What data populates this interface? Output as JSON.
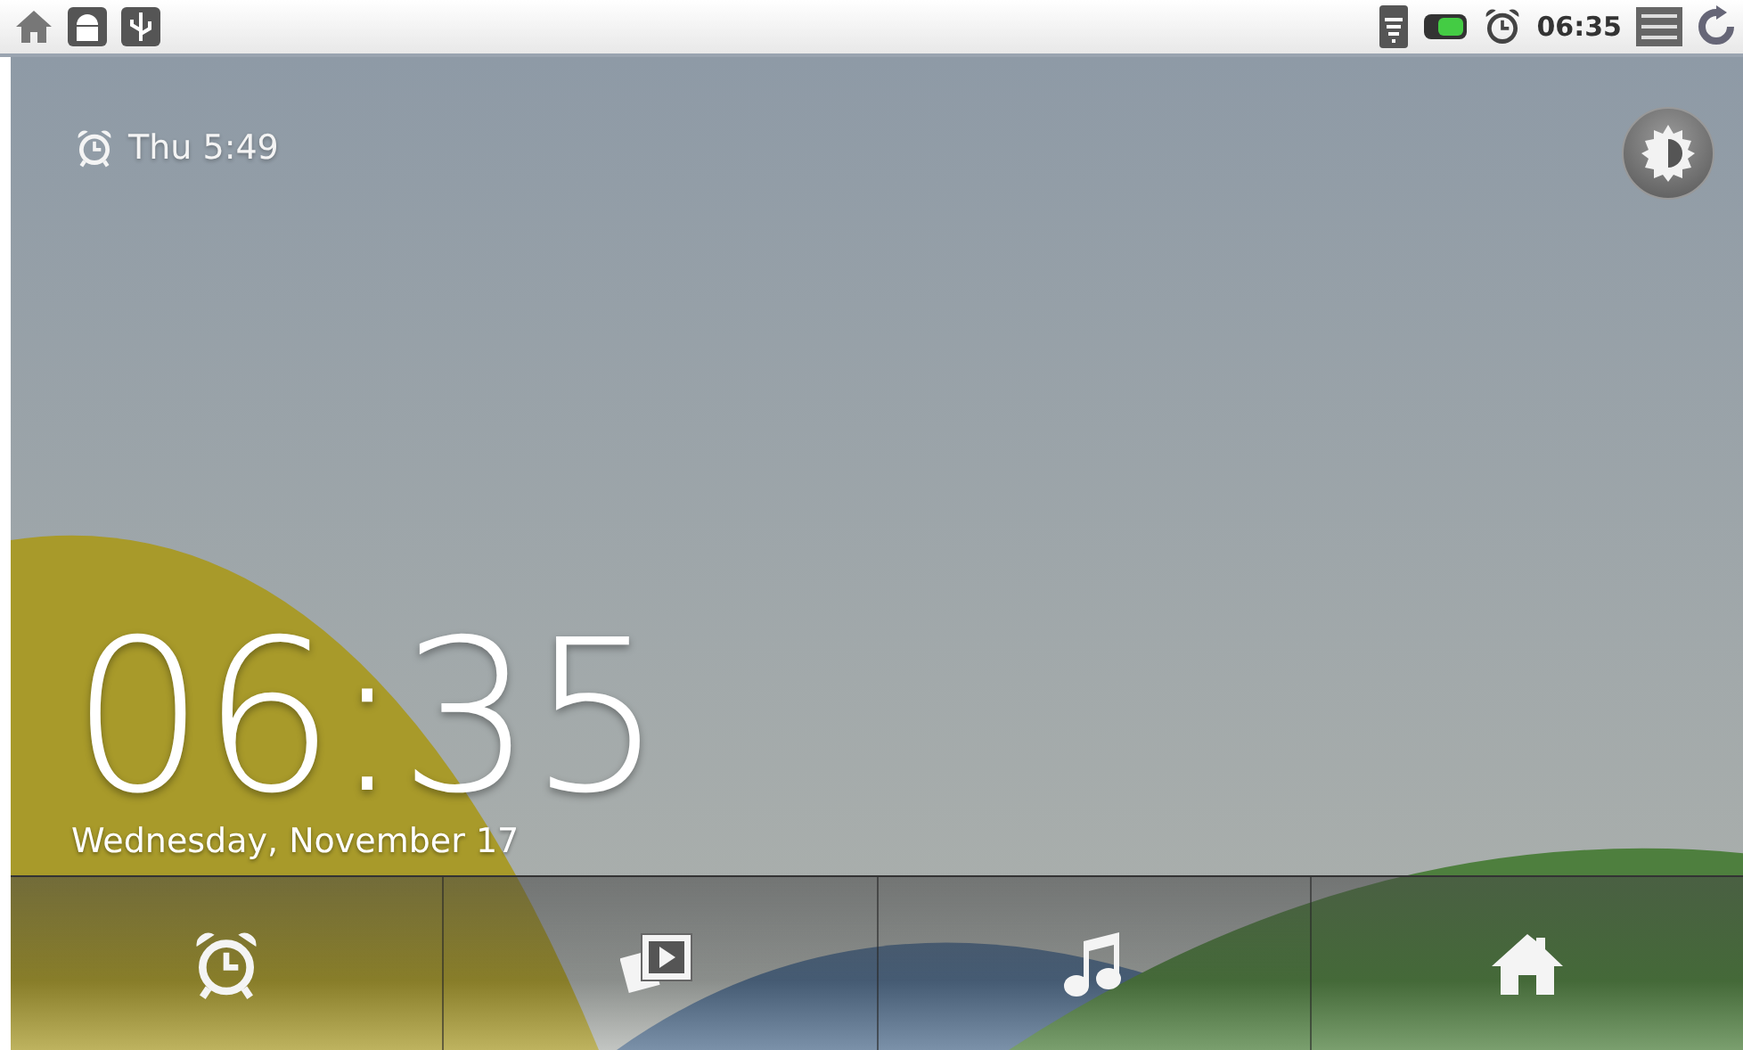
{
  "status_bar": {
    "time": "06:35"
  },
  "next_alarm": "Thu 5:49",
  "clock": {
    "time": "06:35",
    "date": "Wednesday, November 17"
  }
}
